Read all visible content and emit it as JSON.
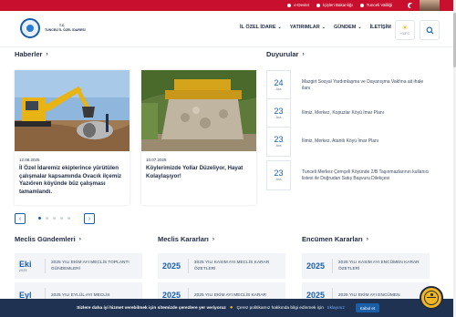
{
  "topbar": {
    "links": [
      "e-Devlet",
      "İçişleri Bakanlığı",
      "Tunceli Valiliği"
    ]
  },
  "header": {
    "logo_line1": "T.C.",
    "logo_line2": "TUNCELİ İL ÖZEL İDARESİ",
    "nav": [
      {
        "label": "İL ÖZEL İDARE",
        "has_menu": true
      },
      {
        "label": "YATIRIMLAR",
        "has_menu": true
      },
      {
        "label": "GÜNDEM",
        "has_menu": true
      },
      {
        "label": "İLETİŞİM",
        "has_menu": false
      }
    ],
    "weather_temp": "+13°C"
  },
  "haberler": {
    "title": "Haberler",
    "cards": [
      {
        "date": "12.08.2025",
        "title": "İl Özel İdaremiz ekiplerince yürütülen çalışmalar kapsamında Ovacık ilçemiz Yazıören köyünde büz çalışması tamamlandı."
      },
      {
        "date": "10.07.2025",
        "title": "Köylerimizde Yollar Düzeliyor, Hayat Kolaylaşıyor!"
      }
    ],
    "slide_count": 5,
    "active_slide": 0
  },
  "duyurular": {
    "title": "Duyurular",
    "items": [
      {
        "day": "24",
        "month": "Ara",
        "text": "Mazgirt Sosyal Yardımlaşma ve Dayanışma Vakfına ait ihale ilanı"
      },
      {
        "day": "23",
        "month": "Ara",
        "text": "İlimiz, Merkez, Kopuzlar Köyü İmar Planı"
      },
      {
        "day": "23",
        "month": "Ara",
        "text": "İlimiz, Merkez, Atantlı Köyü İmar Planı"
      },
      {
        "day": "23",
        "month": "Ara",
        "text": "Tunceli Merkez Çemçeli Köyünde 2/B Taşınmazlarının kullanıcı listesi ile Doğrudan Satış Başvuru Dilekçesi"
      }
    ]
  },
  "meclis_gundemleri": {
    "title": "Meclis Gündemleri",
    "items": [
      {
        "month": "Eki",
        "year": "2025",
        "text": "2025 YILI EKİM AYI MECLİS TOPLANTI GÜNDEMLERİ"
      },
      {
        "month": "Eyl",
        "year": "",
        "text": "2025 YILI EYLÜL AYI MECLİS"
      }
    ]
  },
  "meclis_kararlari": {
    "title": "Meclis Kararları",
    "items": [
      {
        "year": "2025",
        "text": "2025 YILI KASIM AYI MECLİS KARAR ÖZETLERİ"
      },
      {
        "year": "2025",
        "text": "2025 YILI EKİM AYI MECLİS KARAR"
      }
    ]
  },
  "encumen_kararlari": {
    "title": "Encümen Kararları",
    "items": [
      {
        "year": "2025",
        "text": "2025 YILI KASIM AYI ENCÜMEN KARAR ÖZETLERİ"
      },
      {
        "year": "2025",
        "text": "2025 YILI EKİM AYI ENCÜMEN"
      }
    ]
  },
  "cookie": {
    "text_bold": "Sizlere daha iyi hizmet verebilmek için sitemizde çerezlere yer veriyoruz",
    "text_rest": "Çerez politikamız hakkında bilgi edinmek için",
    "link": "tıklayınız",
    "accept": "Kabul et"
  },
  "colors": {
    "brand_red": "#c8102e",
    "brand_blue": "#1a5ea8",
    "text_dark": "#1f2a44",
    "cookie_bg": "#1f3251"
  }
}
